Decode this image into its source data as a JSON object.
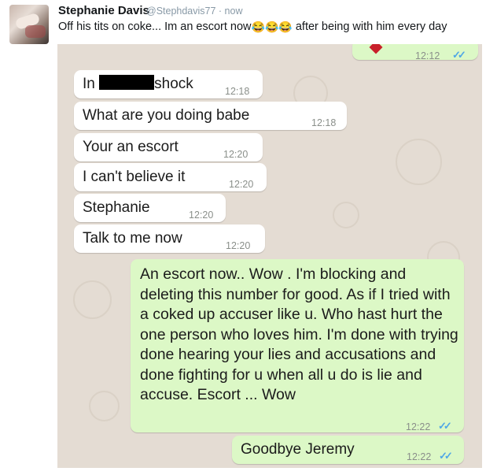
{
  "tweet": {
    "author_name": "Stephanie Davis",
    "handle_time": "@Stephdavis77 · now",
    "text_before": "Off his tits on coke... Im an escort now",
    "emojis": [
      "😂",
      "😂",
      "😂"
    ],
    "text_after": " after being with him every day"
  },
  "chat": {
    "top_time": "12:12",
    "messages": [
      {
        "text_before": "In ",
        "text_after": "shock",
        "time": "12:18"
      },
      {
        "text": "What are you doing babe",
        "time": "12:18"
      },
      {
        "text": "Your an escort",
        "time": "12:20"
      },
      {
        "text": "I can't believe it",
        "time": "12:20"
      },
      {
        "text": "Stephanie",
        "time": "12:20"
      },
      {
        "text": "Talk to me now",
        "time": "12:20"
      },
      {
        "text": "An escort now.. Wow . I'm blocking and deleting this number for good. As if I tried with a coked up accuser like u. Who hast hurt the one person who loves him. I'm done with trying done hearing your lies and accusations and done fighting for u when all u do is lie and accuse. Escort ... Wow",
        "time": "12:22"
      },
      {
        "text": "Goodbye Jeremy",
        "time": "12:22"
      }
    ],
    "tick_glyph": "✓✓"
  }
}
